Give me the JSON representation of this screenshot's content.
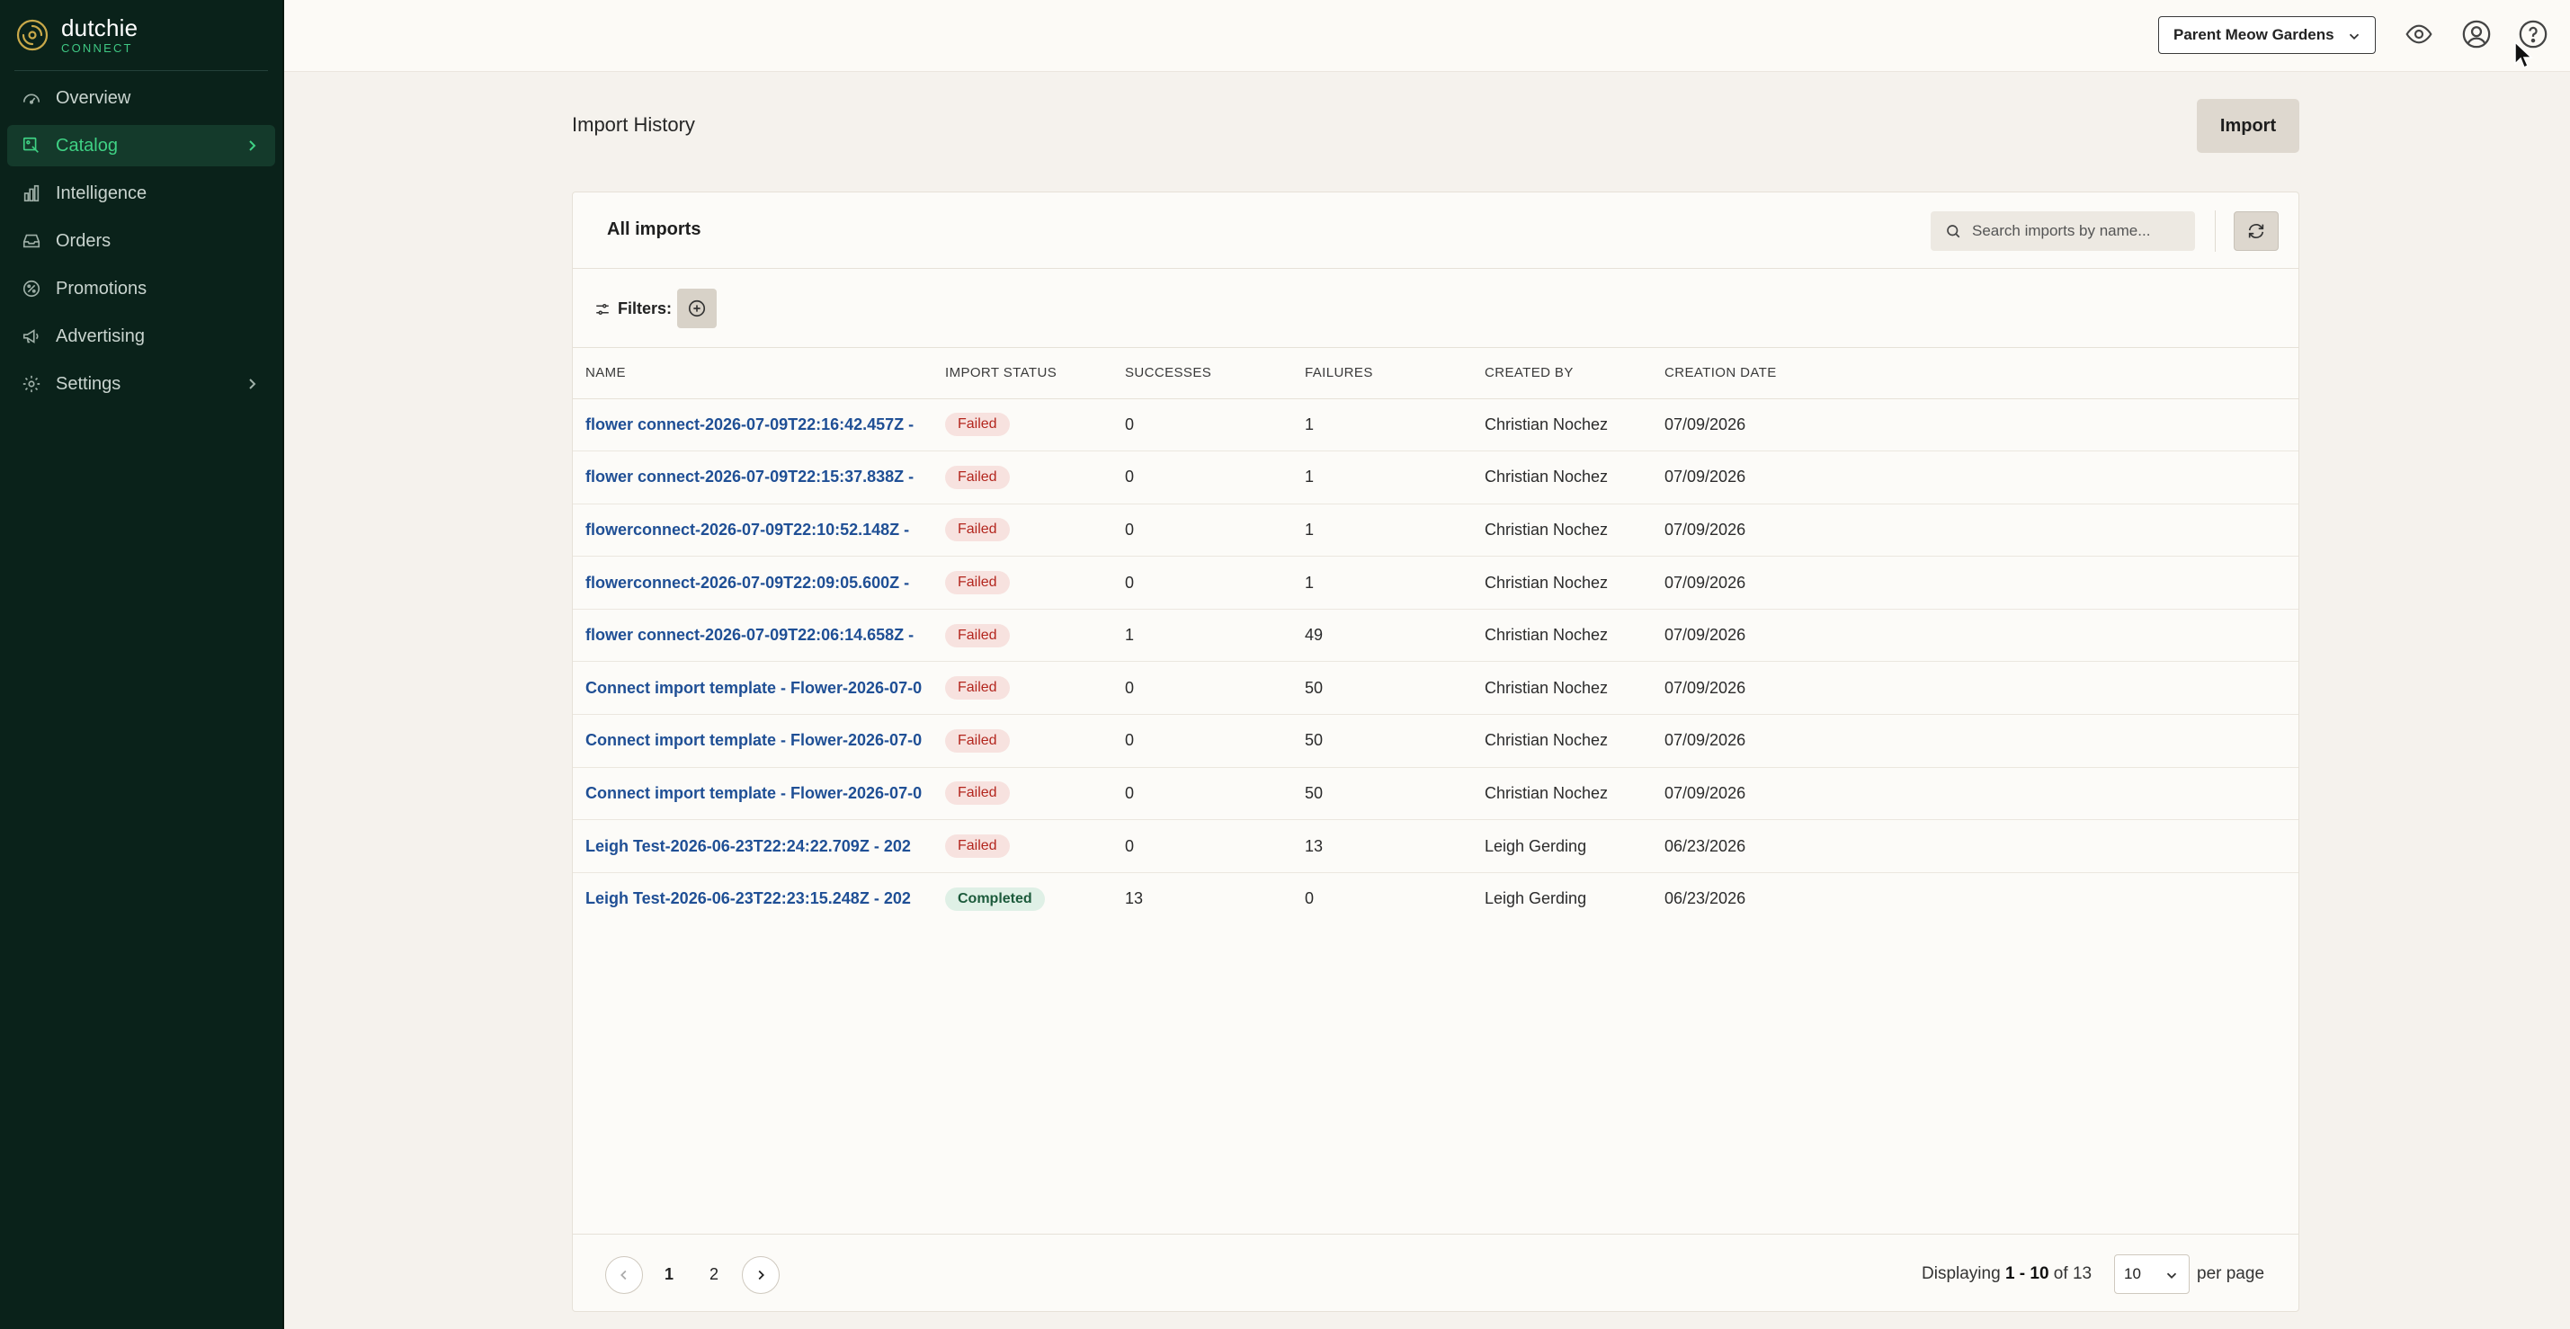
{
  "brand": {
    "name": "dutchie",
    "sub": "CONNECT"
  },
  "sidebar": {
    "items": [
      {
        "label": "Overview",
        "icon": "gauge-icon"
      },
      {
        "label": "Catalog",
        "icon": "tag-icon",
        "active": true
      },
      {
        "label": "Intelligence",
        "icon": "bar-chart-icon"
      },
      {
        "label": "Orders",
        "icon": "inbox-icon"
      },
      {
        "label": "Promotions",
        "icon": "percent-badge-icon"
      },
      {
        "label": "Advertising",
        "icon": "megaphone-icon"
      },
      {
        "label": "Settings",
        "icon": "gear-icon"
      }
    ]
  },
  "topbar": {
    "org": "Parent Meow Gardens",
    "icons": [
      "eye-icon",
      "user-icon",
      "help-icon"
    ]
  },
  "page": {
    "title": "Import History",
    "import_label": "Import"
  },
  "card": {
    "title": "All imports",
    "search_placeholder": "Search imports by name...",
    "filters_label": "Filters:"
  },
  "table": {
    "headers": [
      "NAME",
      "IMPORT STATUS",
      "SUCCESSES",
      "FAILURES",
      "CREATED BY",
      "CREATION DATE"
    ],
    "rows": [
      {
        "name": "flower connect-2026-07-09T22:16:42.457Z -",
        "status": "Failed",
        "successes": "0",
        "failures": "1",
        "created_by": "Christian Nochez",
        "date": "07/09/2026"
      },
      {
        "name": "flower connect-2026-07-09T22:15:37.838Z -",
        "status": "Failed",
        "successes": "0",
        "failures": "1",
        "created_by": "Christian Nochez",
        "date": "07/09/2026"
      },
      {
        "name": "flowerconnect-2026-07-09T22:10:52.148Z -",
        "status": "Failed",
        "successes": "0",
        "failures": "1",
        "created_by": "Christian Nochez",
        "date": "07/09/2026"
      },
      {
        "name": "flowerconnect-2026-07-09T22:09:05.600Z -",
        "status": "Failed",
        "successes": "0",
        "failures": "1",
        "created_by": "Christian Nochez",
        "date": "07/09/2026"
      },
      {
        "name": "flower connect-2026-07-09T22:06:14.658Z -",
        "status": "Failed",
        "successes": "1",
        "failures": "49",
        "created_by": "Christian Nochez",
        "date": "07/09/2026"
      },
      {
        "name": "Connect import template - Flower-2026-07-0",
        "status": "Failed",
        "successes": "0",
        "failures": "50",
        "created_by": "Christian Nochez",
        "date": "07/09/2026"
      },
      {
        "name": "Connect import template - Flower-2026-07-0",
        "status": "Failed",
        "successes": "0",
        "failures": "50",
        "created_by": "Christian Nochez",
        "date": "07/09/2026"
      },
      {
        "name": "Connect import template - Flower-2026-07-0",
        "status": "Failed",
        "successes": "0",
        "failures": "50",
        "created_by": "Christian Nochez",
        "date": "07/09/2026"
      },
      {
        "name": "Leigh Test-2026-06-23T22:24:22.709Z - 202",
        "status": "Failed",
        "successes": "0",
        "failures": "13",
        "created_by": "Leigh Gerding",
        "date": "06/23/2026"
      },
      {
        "name": "Leigh Test-2026-06-23T22:23:15.248Z - 202",
        "status": "Completed",
        "successes": "13",
        "failures": "0",
        "created_by": "Leigh Gerding",
        "date": "06/23/2026"
      }
    ]
  },
  "pagination": {
    "pages": [
      "1",
      "2"
    ],
    "current": "1",
    "displaying_prefix": "Displaying ",
    "range": "1 - 10",
    "of_text": " of ",
    "total": "13",
    "per_page_value": "10",
    "per_page_label": "per page"
  },
  "colors": {
    "sidebar_bg": "#0a221a",
    "accent": "#3fd184",
    "link": "#1f4f95",
    "failed": "#b3261e",
    "completed": "#1c5a3b"
  }
}
